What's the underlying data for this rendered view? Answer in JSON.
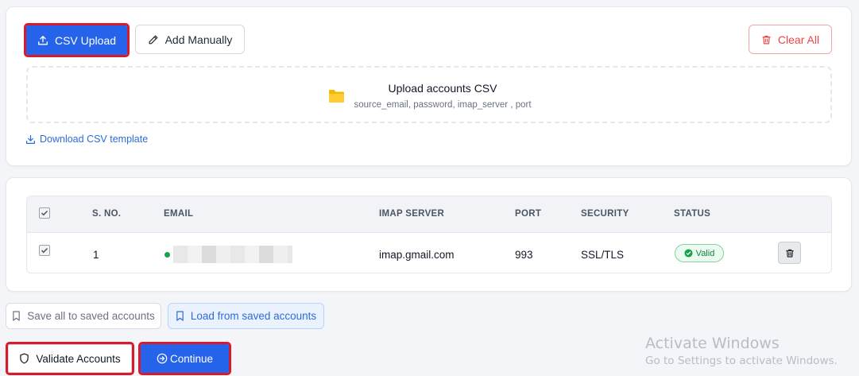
{
  "upload_panel": {
    "csv_upload_label": "CSV Upload",
    "add_manually_label": "Add Manually",
    "clear_all_label": "Clear All",
    "dropzone_title": "Upload accounts CSV",
    "dropzone_subtitle": "source_email, password, imap_server , port",
    "download_template_label": "Download CSV template"
  },
  "table": {
    "headers": {
      "sno": "S. NO.",
      "email": "EMAIL",
      "imap_server": "IMAP SERVER",
      "port": "PORT",
      "security": "SECURITY",
      "status": "STATUS"
    },
    "rows": [
      {
        "sno": "1",
        "email": "",
        "imap_server": "imap.gmail.com",
        "port": "993",
        "security": "SSL/TLS",
        "status": "Valid",
        "checked": true
      }
    ],
    "header_checked": true
  },
  "saved": {
    "save_all_label": "Save all to saved accounts",
    "load_label": "Load from saved accounts"
  },
  "actions": {
    "validate_label": "Validate Accounts",
    "continue_label": "Continue"
  },
  "watermark": {
    "title": "Activate Windows",
    "subtitle": "Go to Settings to activate Windows."
  },
  "colors": {
    "primary": "#2563eb",
    "danger": "#ef4444",
    "success": "#15803d",
    "highlight_outline": "#d81b2a"
  },
  "icons": {
    "csv_upload": "upload-icon",
    "add_manually": "pencil-icon",
    "clear_all": "trash-icon",
    "dropzone": "folder-icon",
    "download": "download-icon",
    "status_valid": "check-circle-icon",
    "row_delete": "trash-icon",
    "save": "bookmark-icon",
    "load": "bookmark-icon",
    "validate": "shield-icon",
    "continue": "arrow-circle-right-icon"
  }
}
